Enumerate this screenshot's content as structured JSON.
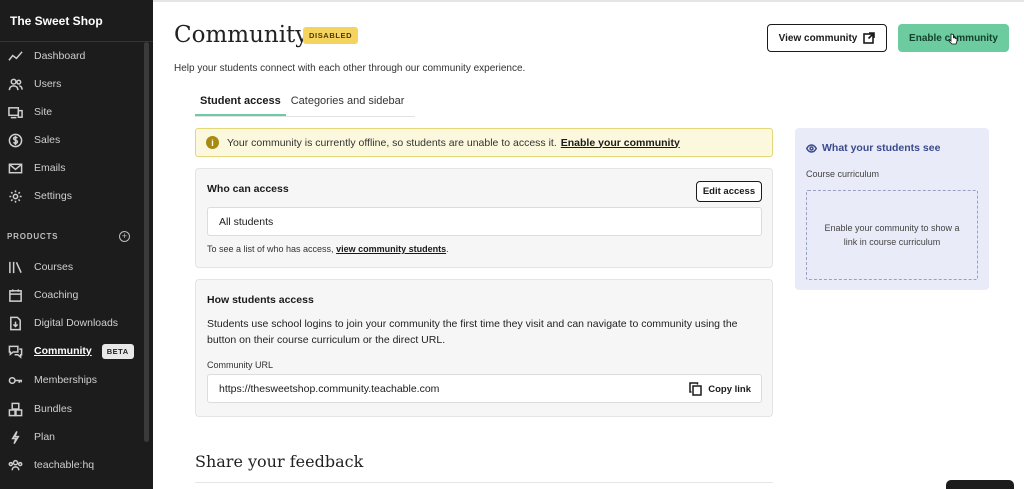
{
  "sidebar": {
    "brand": "The Sweet Shop",
    "items": [
      {
        "label": "Dashboard",
        "icon": "chart-line-icon"
      },
      {
        "label": "Users",
        "icon": "users-icon"
      },
      {
        "label": "Site",
        "icon": "monitor-icon"
      },
      {
        "label": "Sales",
        "icon": "dollar-icon"
      },
      {
        "label": "Emails",
        "icon": "mail-icon"
      },
      {
        "label": "Settings",
        "icon": "gear-icon"
      }
    ],
    "section_label": "PRODUCTS",
    "product_items": [
      {
        "label": "Courses",
        "icon": "library-icon"
      },
      {
        "label": "Coaching",
        "icon": "calendar-icon"
      },
      {
        "label": "Digital Downloads",
        "icon": "download-icon"
      },
      {
        "label": "Community",
        "icon": "chat-icon",
        "badge": "BETA",
        "active": true
      },
      {
        "label": "Memberships",
        "icon": "key-icon"
      },
      {
        "label": "Bundles",
        "icon": "bundle-icon"
      },
      {
        "label": "Plan",
        "icon": "bolt-icon"
      },
      {
        "label": "teachable:hq",
        "icon": "group-icon"
      }
    ]
  },
  "header": {
    "title": "Community",
    "status_badge": "DISABLED",
    "subtitle": "Help your students connect with each other through our community experience.",
    "view_button": "View community",
    "enable_button": "Enable community"
  },
  "tabs": [
    {
      "label": "Student access",
      "active": true
    },
    {
      "label": "Categories and sidebar",
      "active": false
    }
  ],
  "alert": {
    "text": "Your community is currently offline, so students are unable to access it.",
    "link": "Enable your community"
  },
  "who_can_access": {
    "title": "Who can access",
    "edit_button": "Edit access",
    "value": "All students",
    "note_prefix": "To see a list of who has access,",
    "note_link": "view community students",
    "note_suffix": "."
  },
  "how_students_access": {
    "title": "How students access",
    "body": "Students use school logins to join your community the first time they visit and can navigate to community using the button on their course curriculum or the direct URL.",
    "url_label": "Community URL",
    "url": "https://thesweetshop.community.teachable.com",
    "copy_button": "Copy link"
  },
  "feedback": {
    "title": "Share your feedback"
  },
  "preview": {
    "title": "What your students see",
    "subtitle": "Course curriculum",
    "placeholder": "Enable your community to show a link in course curriculum"
  },
  "colors": {
    "sidebar_bg": "#1c1c1c",
    "accent_green": "#6ccb9f",
    "badge_yellow": "#f4d35e",
    "alert_bg": "#fcf8dd",
    "preview_bg": "#e9ebf8"
  }
}
